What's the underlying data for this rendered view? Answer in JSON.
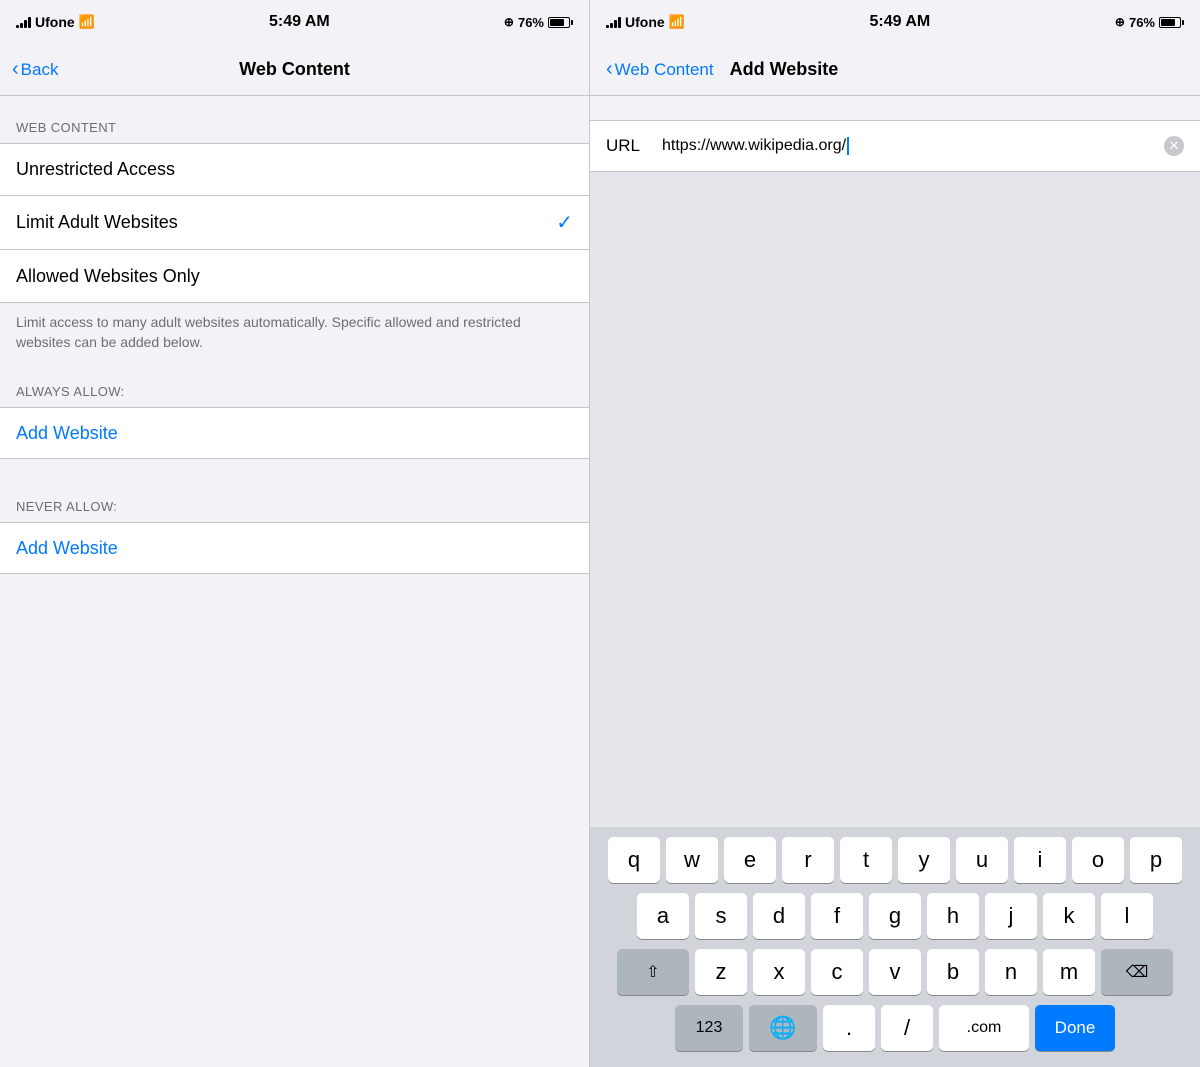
{
  "left": {
    "statusBar": {
      "carrier": "Ufone",
      "time": "5:49 AM",
      "battery": "76%"
    },
    "navBar": {
      "backLabel": "Back",
      "title": "Web Content"
    },
    "sectionHeader": "WEB CONTENT",
    "items": [
      {
        "label": "Unrestricted Access",
        "checked": false
      },
      {
        "label": "Limit Adult Websites",
        "checked": true
      },
      {
        "label": "Allowed Websites Only",
        "checked": false
      }
    ],
    "sectionDesc": "Limit access to many adult websites automatically. Specific allowed and restricted websites can be added below.",
    "alwaysAllowLabel": "ALWAYS ALLOW:",
    "alwaysAllowBtn": "Add Website",
    "neverAllowLabel": "NEVER ALLOW:",
    "neverAllowBtn": "Add Website"
  },
  "right": {
    "statusBar": {
      "carrier": "Ufone",
      "time": "5:49 AM",
      "battery": "76%"
    },
    "navBar": {
      "backLabel": "Web Content",
      "title": "Add Website"
    },
    "urlLabel": "URL",
    "urlValue": "https://www.wikipedia.org/",
    "keyboard": {
      "row1": [
        "q",
        "w",
        "e",
        "r",
        "t",
        "y",
        "u",
        "i",
        "o",
        "p"
      ],
      "row2": [
        "a",
        "s",
        "d",
        "f",
        "g",
        "h",
        "j",
        "k",
        "l"
      ],
      "row3": [
        "z",
        "x",
        "c",
        "v",
        "b",
        "n",
        "m"
      ],
      "bottomLeft": "123",
      "globe": "🌐",
      "dot": ".",
      "slash": "/",
      "dotcom": ".com",
      "done": "Done"
    }
  }
}
